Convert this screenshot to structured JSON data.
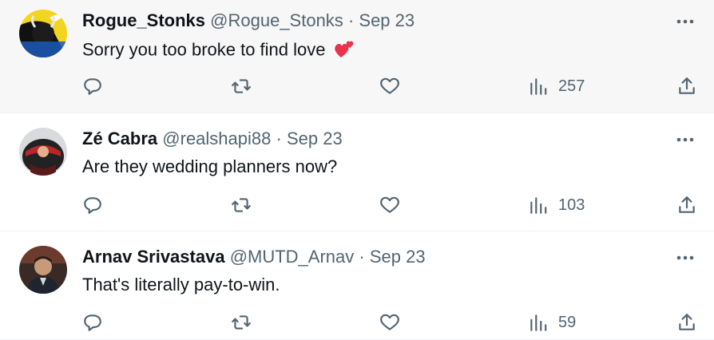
{
  "tweets": [
    {
      "name": "Rogue_Stonks",
      "handle": "@Rogue_Stonks",
      "separator": "·",
      "date": "Sep 23",
      "text": "Sorry you too broke to find love",
      "emoji": "two-hearts",
      "views": "257",
      "highlighted": true
    },
    {
      "name": "Zé Cabra",
      "handle": "@realshapi88",
      "separator": "·",
      "date": "Sep 23",
      "text": "Are they wedding planners now?",
      "views": "103",
      "highlighted": false
    },
    {
      "name": "Arnav Srivastava",
      "handle": "@MUTD_Arnav",
      "separator": "·",
      "date": "Sep 23",
      "text": "That's literally pay-to-win.",
      "views": "59",
      "highlighted": false
    }
  ],
  "icons": {
    "reply": "reply-icon",
    "retweet": "retweet-icon",
    "like": "heart-icon",
    "views": "views-icon",
    "share": "share-icon",
    "more": "more-icon"
  },
  "colors": {
    "text_primary": "#0f1419",
    "text_secondary": "#536471",
    "highlight_bg": "#f7f7f7",
    "divider": "#eff3f4",
    "heart": "#e8334a"
  }
}
